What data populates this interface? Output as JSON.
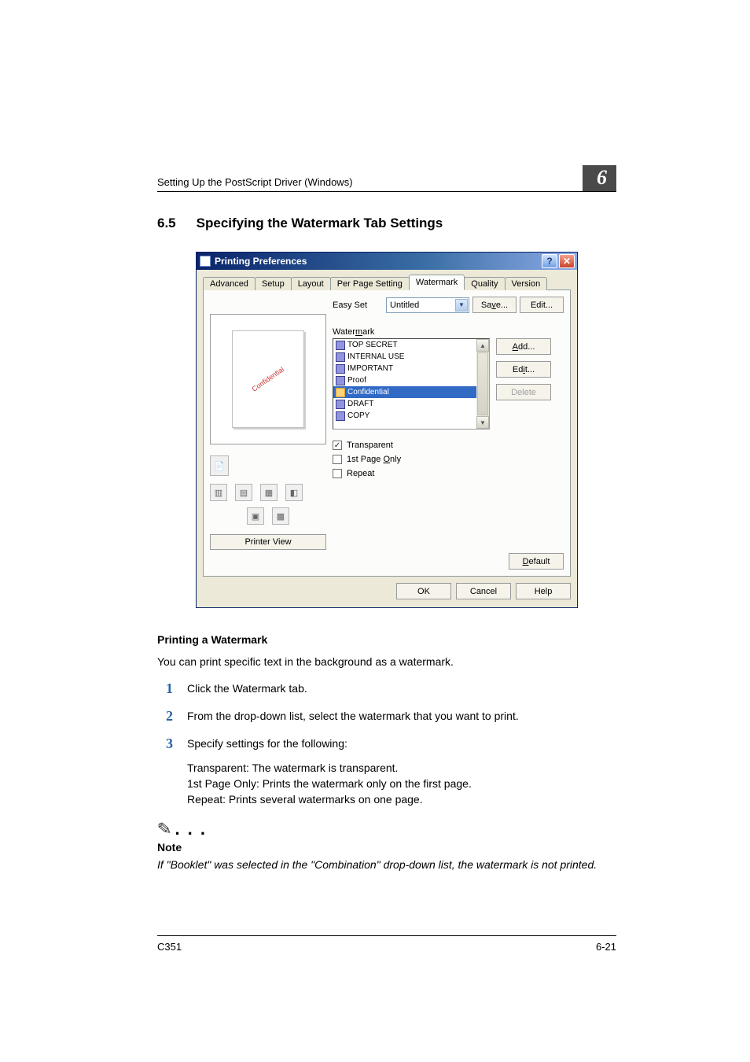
{
  "page": {
    "running_head": "Setting Up the PostScript Driver (Windows)",
    "chapter_number": "6",
    "section_number": "6.5",
    "section_title": "Specifying the Watermark Tab Settings",
    "footer_left": "C351",
    "footer_right": "6-21"
  },
  "dialog": {
    "title": "Printing Preferences",
    "tabs": [
      "Advanced",
      "Setup",
      "Layout",
      "Per Page Setting",
      "Watermark",
      "Quality",
      "Version"
    ],
    "active_tab_index": 4,
    "easy_set_label": "Easy Set",
    "easy_set_value": "Untitled",
    "save_btn": "Save...",
    "edit_top_btn": "Edit...",
    "watermark_label": "Watermark",
    "preview_text": "Confidential",
    "list_items": [
      "TOP SECRET",
      "INTERNAL USE",
      "IMPORTANT",
      "Proof",
      "Confidential",
      "DRAFT",
      "COPY"
    ],
    "selected_list_index": 4,
    "add_btn": "Add...",
    "edit_btn": "Edit...",
    "delete_btn": "Delete",
    "transparent_label": "Transparent",
    "transparent_checked": true,
    "first_page_label": "1st Page Only",
    "repeat_label": "Repeat",
    "printer_view_btn": "Printer View",
    "default_btn": "Default",
    "ok_btn": "OK",
    "cancel_btn": "Cancel",
    "help_btn": "Help"
  },
  "content": {
    "sub_heading": "Printing a Watermark",
    "intro": "You can print specific text in the background as a watermark.",
    "step1": "Click the Watermark tab.",
    "step2": "From the drop-down list, select the watermark that you want to print.",
    "step3": "Specify settings for the following:",
    "step3_line1": "Transparent: The watermark is transparent.",
    "step3_line2": "1st Page Only: Prints the watermark only on the first page.",
    "step3_line3": "Repeat: Prints several watermarks on one page.",
    "note_label": "Note",
    "note_body": "If \"Booklet\" was selected in the \"Combination\" drop-down list, the watermark is not printed."
  }
}
